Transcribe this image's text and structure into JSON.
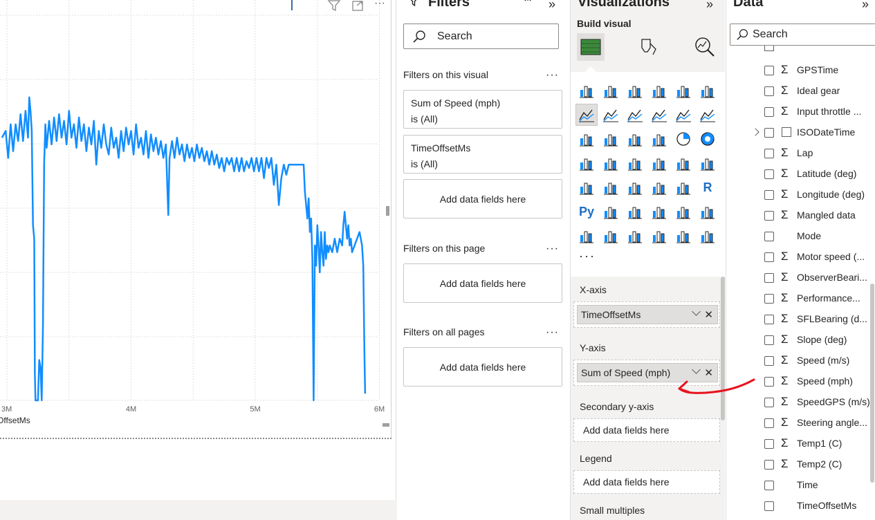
{
  "chart_data": {
    "type": "line",
    "x_tick_labels": [
      "3M",
      "4M",
      "5M",
      "6M"
    ],
    "x_axis_title_visible": "OffsetMs",
    "series": [
      {
        "name": "Sum of Speed (mph)",
        "color": "#118DFF",
        "points": [
          [
            2.96,
            0.78
          ],
          [
            2.99,
            0.8
          ],
          [
            3.01,
            0.72
          ],
          [
            3.03,
            0.82
          ],
          [
            3.05,
            0.74
          ],
          [
            3.07,
            0.82
          ],
          [
            3.09,
            0.77
          ],
          [
            3.11,
            0.85
          ],
          [
            3.13,
            0.77
          ],
          [
            3.15,
            0.86
          ],
          [
            3.17,
            0.78
          ],
          [
            3.18,
            0.9
          ],
          [
            3.19,
            0.86
          ],
          [
            3.2,
            0.8
          ],
          [
            3.21,
            0.52
          ],
          [
            3.22,
            0.48
          ],
          [
            3.225,
            0.08
          ],
          [
            3.23,
            0.0
          ],
          [
            3.25,
            0.0
          ],
          [
            3.26,
            0.12
          ],
          [
            3.27,
            0.1
          ],
          [
            3.28,
            0.0
          ],
          [
            3.29,
            0.22
          ],
          [
            3.3,
            0.7
          ],
          [
            3.31,
            0.82
          ],
          [
            3.32,
            0.75
          ],
          [
            3.34,
            0.83
          ],
          [
            3.36,
            0.76
          ],
          [
            3.38,
            0.84
          ],
          [
            3.4,
            0.77
          ],
          [
            3.42,
            0.85
          ],
          [
            3.44,
            0.78
          ],
          [
            3.46,
            0.83
          ],
          [
            3.48,
            0.76
          ],
          [
            3.5,
            0.86
          ],
          [
            3.52,
            0.78
          ],
          [
            3.54,
            0.82
          ],
          [
            3.56,
            0.75
          ],
          [
            3.58,
            0.84
          ],
          [
            3.6,
            0.77
          ],
          [
            3.62,
            0.82
          ],
          [
            3.64,
            0.74
          ],
          [
            3.66,
            0.81
          ],
          [
            3.68,
            0.76
          ],
          [
            3.7,
            0.83
          ],
          [
            3.72,
            0.7
          ],
          [
            3.74,
            0.8
          ],
          [
            3.76,
            0.75
          ],
          [
            3.78,
            0.82
          ],
          [
            3.8,
            0.76
          ],
          [
            3.82,
            0.73
          ],
          [
            3.84,
            0.81
          ],
          [
            3.86,
            0.75
          ],
          [
            3.88,
            0.78
          ],
          [
            3.9,
            0.72
          ],
          [
            3.92,
            0.8
          ],
          [
            3.94,
            0.74
          ],
          [
            3.96,
            0.81
          ],
          [
            3.98,
            0.76
          ],
          [
            4.0,
            0.8
          ],
          [
            4.02,
            0.73
          ],
          [
            4.04,
            0.82
          ],
          [
            4.06,
            0.75
          ],
          [
            4.08,
            0.78
          ],
          [
            4.1,
            0.73
          ],
          [
            4.12,
            0.8
          ],
          [
            4.14,
            0.72
          ],
          [
            4.16,
            0.79
          ],
          [
            4.18,
            0.74
          ],
          [
            4.2,
            0.78
          ],
          [
            4.22,
            0.73
          ],
          [
            4.24,
            0.77
          ],
          [
            4.26,
            0.72
          ],
          [
            4.28,
            0.76
          ],
          [
            4.3,
            0.55
          ],
          [
            4.31,
            0.72
          ],
          [
            4.33,
            0.77
          ],
          [
            4.35,
            0.72
          ],
          [
            4.37,
            0.78
          ],
          [
            4.39,
            0.73
          ],
          [
            4.41,
            0.76
          ],
          [
            4.43,
            0.71
          ],
          [
            4.45,
            0.76
          ],
          [
            4.47,
            0.72
          ],
          [
            4.49,
            0.75
          ],
          [
            4.51,
            0.71
          ],
          [
            4.53,
            0.76
          ],
          [
            4.55,
            0.72
          ],
          [
            4.57,
            0.75
          ],
          [
            4.59,
            0.71
          ],
          [
            4.61,
            0.74
          ],
          [
            4.63,
            0.7
          ],
          [
            4.65,
            0.74
          ],
          [
            4.67,
            0.7
          ],
          [
            4.69,
            0.73
          ],
          [
            4.71,
            0.69
          ],
          [
            4.73,
            0.72
          ],
          [
            4.75,
            0.68
          ],
          [
            4.77,
            0.72
          ],
          [
            4.79,
            0.7
          ],
          [
            4.81,
            0.72
          ],
          [
            4.83,
            0.68
          ],
          [
            4.85,
            0.72
          ],
          [
            4.87,
            0.68
          ],
          [
            4.89,
            0.72
          ],
          [
            4.91,
            0.68
          ],
          [
            4.93,
            0.71
          ],
          [
            4.95,
            0.69
          ],
          [
            4.97,
            0.72
          ],
          [
            4.99,
            0.68
          ],
          [
            5.01,
            0.72
          ],
          [
            5.03,
            0.68
          ],
          [
            5.05,
            0.72
          ],
          [
            5.07,
            0.66
          ],
          [
            5.09,
            0.72
          ],
          [
            5.11,
            0.69
          ],
          [
            5.13,
            0.72
          ],
          [
            5.15,
            0.64
          ],
          [
            5.17,
            0.7
          ],
          [
            5.19,
            0.58
          ],
          [
            5.21,
            0.66
          ],
          [
            5.23,
            0.7
          ],
          [
            5.25,
            0.67
          ],
          [
            5.27,
            0.7
          ],
          [
            5.3,
            0.7
          ],
          [
            5.33,
            0.7
          ],
          [
            5.36,
            0.7
          ],
          [
            5.39,
            0.7
          ],
          [
            5.4,
            0.62
          ],
          [
            5.41,
            0.58
          ],
          [
            5.42,
            0.54
          ],
          [
            5.43,
            0.6
          ],
          [
            5.44,
            0.5
          ],
          [
            5.45,
            0.54
          ],
          [
            5.46,
            0.42
          ],
          [
            5.47,
            0.0
          ],
          [
            5.48,
            0.46
          ],
          [
            5.49,
            0.4
          ],
          [
            5.5,
            0.52
          ],
          [
            5.51,
            0.46
          ],
          [
            5.52,
            0.38
          ],
          [
            5.53,
            0.5
          ],
          [
            5.54,
            0.44
          ],
          [
            5.55,
            0.4
          ],
          [
            5.56,
            0.5
          ],
          [
            5.57,
            0.42
          ],
          [
            5.58,
            0.46
          ],
          [
            5.59,
            0.44
          ],
          [
            5.6,
            0.46
          ],
          [
            5.62,
            0.44
          ],
          [
            5.64,
            0.48
          ],
          [
            5.66,
            0.44
          ],
          [
            5.68,
            0.48
          ],
          [
            5.7,
            0.46
          ],
          [
            5.71,
            0.52
          ],
          [
            5.72,
            0.56
          ],
          [
            5.73,
            0.52
          ],
          [
            5.74,
            0.48
          ],
          [
            5.75,
            0.52
          ],
          [
            5.76,
            0.46
          ],
          [
            5.77,
            0.48
          ],
          [
            5.78,
            0.44
          ],
          [
            5.8,
            0.46
          ],
          [
            5.82,
            0.48
          ],
          [
            5.84,
            0.5
          ],
          [
            5.86,
            0.46
          ],
          [
            5.87,
            0.4
          ],
          [
            5.88,
            0.12
          ],
          [
            5.885,
            0.02
          ]
        ]
      }
    ],
    "grid": true
  },
  "visual_header": {
    "icons": [
      "filter-icon",
      "focus-mode-icon",
      "more-options-icon"
    ],
    "more_label": "···"
  },
  "filters": {
    "title": "Filters",
    "search_placeholder": "Search",
    "on_visual_label": "Filters on this visual",
    "on_page_label": "Filters on this page",
    "all_pages_label": "Filters on all pages",
    "more_label": "···",
    "cards": [
      {
        "field": "Sum of Speed (mph)",
        "state": "is (All)"
      },
      {
        "field": "TimeOffsetMs",
        "state": "is (All)"
      }
    ],
    "add_label": "Add data fields here"
  },
  "visualizations": {
    "title": "Visualizations",
    "build_label": "Build visual",
    "more_label": "···",
    "wells": {
      "x_axis_label": "X-axis",
      "x_axis_field": "TimeOffsetMs",
      "y_axis_label": "Y-axis",
      "y_axis_field": "Sum of Speed (mph)",
      "secondary_label": "Secondary y-axis",
      "legend_label": "Legend",
      "small_multiples_label": "Small multiples",
      "add_label": "Add data fields here"
    },
    "r_label": "R",
    "py_label": "Py"
  },
  "data_pane": {
    "title": "Data",
    "search_placeholder": "Search",
    "fields": [
      {
        "name": "GPSTime",
        "sigma": true
      },
      {
        "name": "Ideal gear",
        "sigma": true
      },
      {
        "name": "Input throttle ...",
        "sigma": true
      },
      {
        "name": "ISODateTime",
        "sigma": false,
        "calendar": true,
        "expandable": true
      },
      {
        "name": "Lap",
        "sigma": true
      },
      {
        "name": "Latitude (deg)",
        "sigma": true
      },
      {
        "name": "Longitude (deg)",
        "sigma": true
      },
      {
        "name": "Mangled data",
        "sigma": true
      },
      {
        "name": "Mode",
        "sigma": false
      },
      {
        "name": "Motor speed (...",
        "sigma": true
      },
      {
        "name": "ObserverBeari...",
        "sigma": true
      },
      {
        "name": "Performance...",
        "sigma": true
      },
      {
        "name": "SFLBearing (d...",
        "sigma": true
      },
      {
        "name": "Slope (deg)",
        "sigma": true
      },
      {
        "name": "Speed (m/s)",
        "sigma": true
      },
      {
        "name": "Speed (mph)",
        "sigma": true
      },
      {
        "name": "SpeedGPS (m/s)",
        "sigma": true
      },
      {
        "name": "Steering angle...",
        "sigma": true
      },
      {
        "name": "Temp1 (C)",
        "sigma": true
      },
      {
        "name": "Temp2 (C)",
        "sigma": true
      },
      {
        "name": "Time",
        "sigma": false
      },
      {
        "name": "TimeOffsetMs",
        "sigma": false
      }
    ]
  },
  "colors": {
    "line": "#118DFF",
    "annotation": "#E8141E"
  }
}
